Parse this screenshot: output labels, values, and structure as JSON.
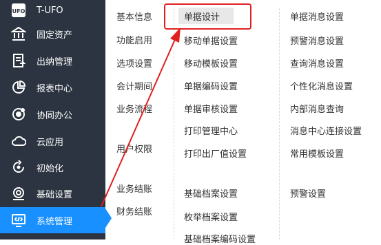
{
  "sidebar": {
    "items": [
      {
        "label": "T-UFO",
        "icon": "ufo-icon"
      },
      {
        "label": "固定资产",
        "icon": "bank-icon"
      },
      {
        "label": "出纳管理",
        "icon": "cashier-icon"
      },
      {
        "label": "报表中心",
        "icon": "pie-chart-icon"
      },
      {
        "label": "协同办公",
        "icon": "collaboration-icon"
      },
      {
        "label": "云应用",
        "icon": "cloud-icon"
      },
      {
        "label": "初始化",
        "icon": "refresh-icon"
      },
      {
        "label": "基础设置",
        "icon": "settings-icon"
      },
      {
        "label": "系统管理",
        "icon": "code-monitor-icon",
        "active": true
      }
    ]
  },
  "menu": {
    "col1": [
      "基本信息",
      "功能启用",
      "选项设置",
      "会计期间",
      "业务流程",
      "用户权限",
      "业务结账",
      "财务结账"
    ],
    "col2": [
      "单据设计",
      "移动单据设置",
      "移动模板设置",
      "单据编码设置",
      "单据审核设置",
      "打印管理中心",
      "打印出厂值设置",
      "基础档案设置",
      "枚举档案设置",
      "基础档案编码设置"
    ],
    "col3": [
      "单据消息设置",
      "预警消息设置",
      "查询消息设置",
      "个性化消息设置",
      "内部消息查询",
      "消息中心连接设置",
      "常用模板设置",
      "预警设置"
    ]
  },
  "colors": {
    "sidebar_bg": "#2b3440",
    "active_bg": "#1890ff",
    "annotation": "#e02020"
  }
}
